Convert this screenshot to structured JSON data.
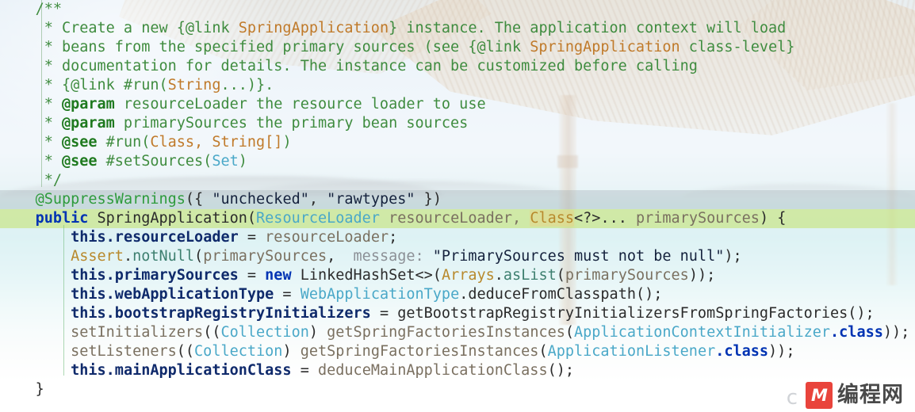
{
  "editor": {
    "language": "java",
    "font_size_px": 18.5,
    "line_height_px": 24,
    "background_image": "tropical-beach-palapa",
    "colors": {
      "comment": "#3f8c3f",
      "comment_link": "#c07a2a",
      "keyword": "#0033b3",
      "annotation": "#2e9b3c",
      "class_name": "#4aa8c8",
      "string": "#15223d",
      "field": "#0f2a6b",
      "parameter": "#7a7060",
      "method": "#3d7f6f",
      "static_ref": "#b8892c",
      "inline_hint": "#8c9096",
      "caret_line_highlight": "#c6e478",
      "dim_line_highlight": "#96a2a8",
      "token_highlight": "#e2d78c"
    }
  },
  "code": {
    "line01": {
      "indent": "    ",
      "comment": "/**"
    },
    "line02": {
      "indent": "     * ",
      "a": "Create a new {@link ",
      "link": "SpringApplication",
      "b": "} instance. The application context will load"
    },
    "line03": {
      "indent": "     * ",
      "a": "beans from the specified primary sources (see {@link ",
      "link": "SpringApplication",
      "b": " class-level}"
    },
    "line04": {
      "indent": "     * ",
      "a": "documentation for details. The instance can be customized before calling"
    },
    "line05": {
      "indent": "     * ",
      "a": "{@link #run(",
      "link": "String",
      "b": "...)}."
    },
    "line06": {
      "indent": "     * ",
      "tag": "@param",
      "a": " resourceLoader the resource loader to use"
    },
    "line07": {
      "indent": "     * ",
      "tag": "@param",
      "a": " primarySources the primary bean sources"
    },
    "line08": {
      "indent": "     * ",
      "tag": "@see",
      "a": " #run(",
      "link": "Class, String[]",
      "b": ")"
    },
    "line09": {
      "indent": "     * ",
      "tag": "@see",
      "a": " #setSources(",
      "link": "Set",
      "b": ")"
    },
    "line10": {
      "indent": "     ",
      "comment": "*/"
    },
    "line11": {
      "indent": "    ",
      "annotation": "@SuppressWarnings",
      "open": "({ ",
      "str1": "\"unchecked\"",
      "sep": ", ",
      "str2": "\"rawtypes\"",
      "close": " })"
    },
    "line12": {
      "indent": "    ",
      "kw": "public",
      "space1": " ",
      "ctor": "SpringApplication",
      "paren": "(",
      "type1": "ResourceLoader",
      "param1": " resourceLoader, ",
      "type2": "Class",
      "generic": "<?>... ",
      "param2": "primarySources",
      "tail": ") {"
    },
    "line13": {
      "indent": "        ",
      "kw": "this",
      "field": ".resourceLoader",
      "eq": " = ",
      "param": "resourceLoader",
      "semi": ";"
    },
    "line14": {
      "indent": "        ",
      "stat": "Assert",
      "dot": ".",
      "method": "notNull",
      "open": "(",
      "arg": "primarySources",
      "comma": ",  ",
      "hint": "message:",
      "space": " ",
      "str": "\"PrimarySources must not be null\"",
      "tail": ");"
    },
    "line15": {
      "indent": "        ",
      "kw": "this",
      "field": ".primarySources",
      "eq": " = ",
      "kw2": "new",
      "type": " LinkedHashSet<>(",
      "stat": "Arrays",
      "dot": ".",
      "method": "asList",
      "open": "(",
      "arg": "primarySources",
      "tail": "));"
    },
    "line16": {
      "indent": "        ",
      "kw": "this",
      "field": ".webApplicationType",
      "eq": " = ",
      "type": "WebApplicationType",
      "dot": ".",
      "method": "deduceFromClasspath",
      "tail": "();"
    },
    "line17": {
      "indent": "        ",
      "kw": "this",
      "field": ".bootstrapRegistryInitializers",
      "eq": " = ",
      "method": "getBootstrapRegistryInitializersFromSpringFactories",
      "tail": "();"
    },
    "line18": {
      "indent": "        ",
      "method": "setInitializers",
      "open": "((",
      "type": "Collection",
      "mid": ") ",
      "method2": "getSpringFactoriesInstances",
      "open2": "(",
      "type2": "ApplicationContextInitializer",
      "kw": ".class",
      "tail": "));"
    },
    "line19": {
      "indent": "        ",
      "method": "setListeners",
      "open": "((",
      "type": "Collection",
      "mid": ") ",
      "method2": "getSpringFactoriesInstances",
      "open2": "(",
      "type2": "ApplicationListener",
      "kw": ".class",
      "tail": "));"
    },
    "line20": {
      "indent": "        ",
      "kw": "this",
      "field": ".mainApplicationClass",
      "eq": " = ",
      "method": "deduceMainApplicationClass",
      "tail": "();"
    },
    "line21": {
      "indent": "    ",
      "brace": "}"
    }
  },
  "watermark": {
    "badge_text": "M",
    "site_name": "编程网",
    "ghost_char": "c"
  }
}
